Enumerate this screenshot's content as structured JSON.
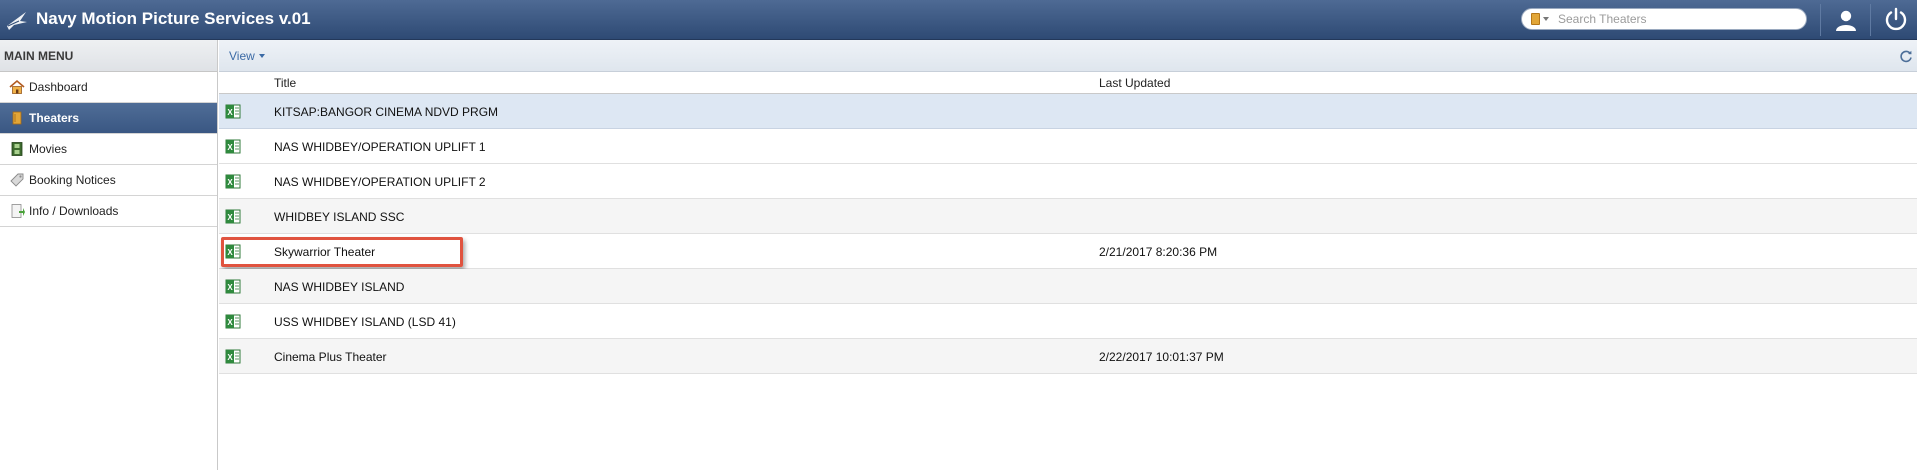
{
  "header": {
    "app_title": "Navy Motion Picture Services v.01",
    "search": {
      "placeholder": "Search Theaters",
      "value": ""
    }
  },
  "sidebar": {
    "title": "MAIN MENU",
    "items": [
      {
        "label": "Dashboard",
        "icon": "house-icon",
        "active": false
      },
      {
        "label": "Theaters",
        "icon": "theater-icon",
        "active": true
      },
      {
        "label": "Movies",
        "icon": "film-icon",
        "active": false
      },
      {
        "label": "Booking Notices",
        "icon": "tag-icon",
        "active": false
      },
      {
        "label": "Info / Downloads",
        "icon": "download-icon",
        "active": false
      }
    ]
  },
  "toolbar": {
    "view_label": "View"
  },
  "table": {
    "columns": {
      "title": "Title",
      "last_updated": "Last Updated"
    },
    "rows": [
      {
        "title": "KITSAP:BANGOR CINEMA NDVD PRGM",
        "last_updated": ""
      },
      {
        "title": "NAS WHIDBEY/OPERATION UPLIFT 1",
        "last_updated": ""
      },
      {
        "title": "NAS WHIDBEY/OPERATION UPLIFT 2",
        "last_updated": ""
      },
      {
        "title": "WHIDBEY ISLAND SSC",
        "last_updated": ""
      },
      {
        "title": "Skywarrior Theater",
        "last_updated": "2/21/2017 8:20:36 PM"
      },
      {
        "title": "NAS WHIDBEY ISLAND",
        "last_updated": ""
      },
      {
        "title": "USS WHIDBEY ISLAND (LSD 41)",
        "last_updated": ""
      },
      {
        "title": "Cinema Plus Theater",
        "last_updated": "2/22/2017 10:01:37 PM"
      }
    ]
  },
  "colors": {
    "header_bg": "#3c5882",
    "active_menu_bg": "#44628d",
    "selected_row_bg": "#dde7f3",
    "highlight_border": "#e0533f",
    "link_blue": "#3b6aa5"
  }
}
